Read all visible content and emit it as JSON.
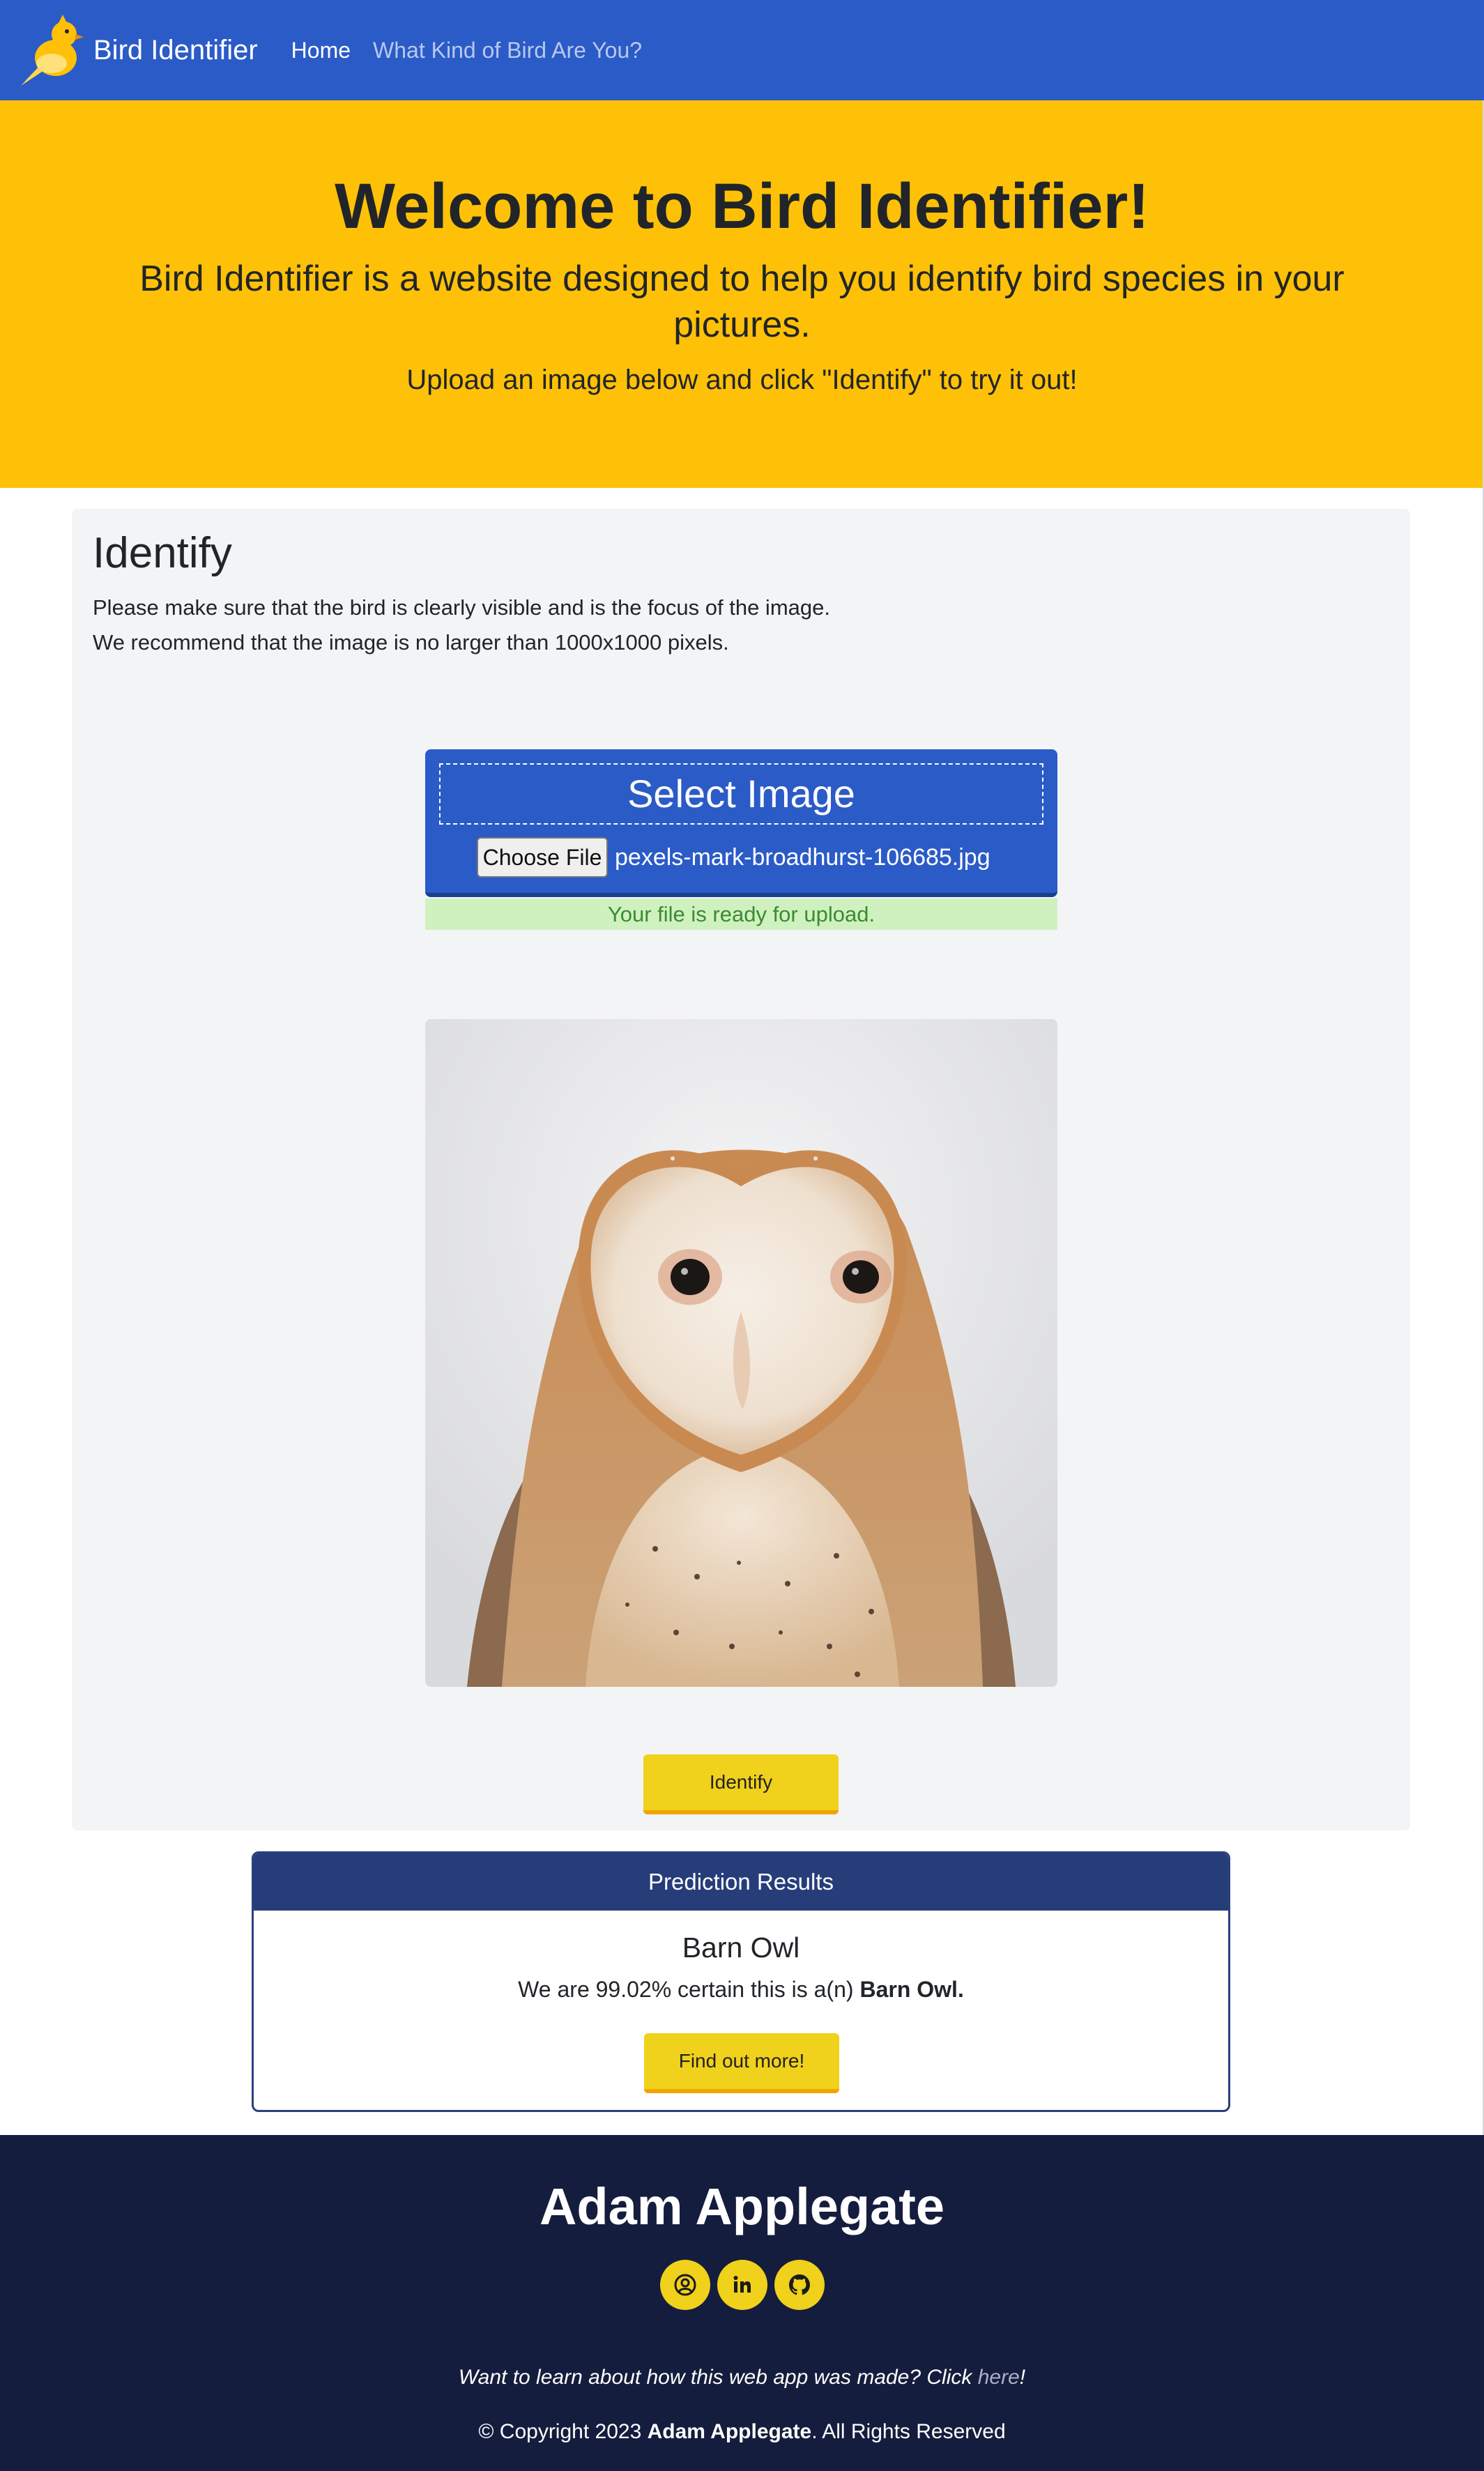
{
  "colors": {
    "navbar": "#2b5bc7",
    "hero": "#ffc107",
    "button": "#f0d11b",
    "footer": "#141d3d",
    "results_header": "#263d7a",
    "success_bg": "#cff1c0",
    "success_text": "#3c8a31"
  },
  "navbar": {
    "brand": "Bird Identifier",
    "logo_icon": "bird-logo-icon",
    "links": [
      {
        "label": "Home",
        "active": true
      },
      {
        "label": "What Kind of Bird Are You?",
        "active": false
      }
    ]
  },
  "hero": {
    "title": "Welcome to Bird Identifier!",
    "lead": "Bird Identifier is a website designed to help you identify bird species in your pictures.",
    "sub": "Upload an image below and click \"Identify\" to try it out!"
  },
  "identify": {
    "title": "Identify",
    "note1": "Please make sure that the bird is clearly visible and is the focus of the image.",
    "note2": "We recommend that the image is no larger than 1000x1000 pixels.",
    "upload_title": "Select Image",
    "choose_file_label": "Choose File",
    "file_name": "pexels-mark-broadhurst-106685.jpg",
    "ready_message": "Your file is ready for upload.",
    "preview_subject": "barn owl photo",
    "identify_button": "Identify"
  },
  "results": {
    "header": "Prediction Results",
    "species": "Barn Owl",
    "text_prefix": "We are 99.02% certain this is a(n) ",
    "text_species": "Barn Owl.",
    "confidence_percent": 99.02,
    "more_button": "Find out more!"
  },
  "footer": {
    "name": "Adam Applegate",
    "social_icons": [
      "user-circle-icon",
      "linkedin-icon",
      "github-icon"
    ],
    "learn_prefix": "Want to learn about how this web app was made? Click ",
    "learn_link": "here",
    "learn_suffix": "!",
    "copyright_prefix": "© Copyright 2023 ",
    "copyright_name": "Adam Applegate",
    "copyright_suffix": ". All Rights Reserved"
  }
}
